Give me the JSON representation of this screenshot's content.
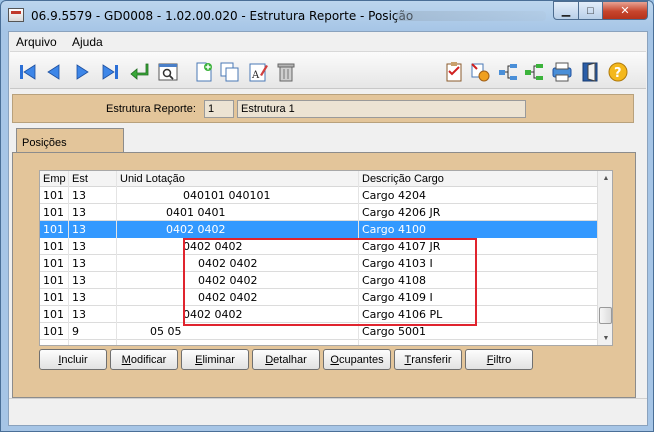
{
  "window": {
    "title": "06.9.5579 - GD0008 - 1.02.00.020 - Estrutura Reporte - Posição",
    "controls": {
      "minimize": "▁",
      "maximize": "□",
      "close": "✕"
    }
  },
  "menu": {
    "arquivo": "Arquivo",
    "ajuda": "Ajuda"
  },
  "toolbar": {
    "icons": [
      "first-icon",
      "prev-icon",
      "next-icon",
      "last-icon",
      "enter-icon",
      "zoom-icon",
      "new-icon",
      "copy-icon",
      "edit-icon",
      "delete-icon",
      "checklist-icon",
      "export-icon",
      "tree-icon",
      "tree-expand-icon",
      "print-icon",
      "exit-icon",
      "help-icon"
    ]
  },
  "header": {
    "label": "Estrutura Reporte:",
    "number": "1",
    "name": "Estrutura 1"
  },
  "tab": {
    "label": "Posições"
  },
  "grid": {
    "columns": {
      "emp": "Emp",
      "est": "Est",
      "unid": "Unid Lotação",
      "desc": "Descrição Cargo"
    },
    "rows": [
      {
        "emp": "101",
        "est": "13",
        "unid": "040101 040101",
        "desc": "Cargo 4204"
      },
      {
        "emp": "101",
        "est": "13",
        "unid": "0401 0401",
        "desc": "Cargo 4206 JR"
      },
      {
        "emp": "101",
        "est": "13",
        "unid": "0402 0402",
        "desc": "Cargo 4100"
      },
      {
        "emp": "101",
        "est": "13",
        "unid": "0402 0402",
        "desc": "Cargo 4107 JR"
      },
      {
        "emp": "101",
        "est": "13",
        "unid": "0402 0402",
        "desc": "Cargo 4103 I"
      },
      {
        "emp": "101",
        "est": "13",
        "unid": "0402 0402",
        "desc": "Cargo 4108"
      },
      {
        "emp": "101",
        "est": "13",
        "unid": "0402 0402",
        "desc": "Cargo 4109 I"
      },
      {
        "emp": "101",
        "est": "13",
        "unid": "0402 0402",
        "desc": "Cargo 4106 PL"
      },
      {
        "emp": "101",
        "est": "9",
        "unid": "05 05",
        "desc": "Cargo 5001"
      }
    ]
  },
  "buttons": {
    "incluir": {
      "first": "I",
      "rest": "ncluir"
    },
    "modificar": {
      "first": "M",
      "rest": "odificar"
    },
    "eliminar": {
      "first": "E",
      "rest": "liminar"
    },
    "detalhar": {
      "first": "D",
      "rest": "etalhar"
    },
    "ocupantes": {
      "first": "O",
      "rest": "cupantes"
    },
    "transferir": {
      "first": "T",
      "rest": "ransferir"
    },
    "filtro": {
      "first": "F",
      "rest": "iltro"
    }
  },
  "colors": {
    "panel": "#e3c59a",
    "selection": "#3399ff",
    "highlight_box": "#e0242e"
  }
}
